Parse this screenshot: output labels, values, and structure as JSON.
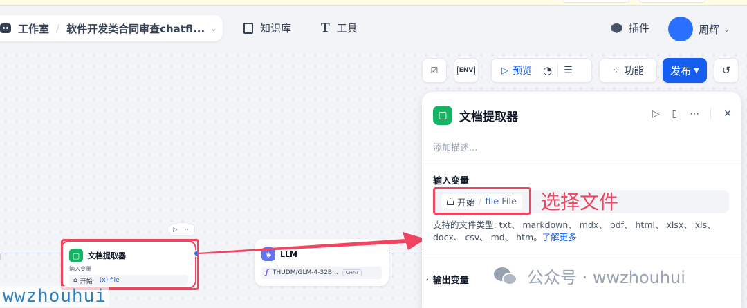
{
  "header": {
    "studio_label": "工作室",
    "app_name": "软件开发类合同审查chatfl...",
    "nav": [
      {
        "label": "知识库",
        "icon": "book-icon"
      },
      {
        "label": "工具",
        "icon": "tool-icon"
      }
    ],
    "plugin_label": "插件",
    "user_name": "周辉"
  },
  "toolbar": {
    "env_label": "ENV",
    "preview_label": "预览",
    "feature_label": "功能",
    "publish_label": "发布"
  },
  "canvas": {
    "doc_node": {
      "title": "文档提取器",
      "input_label": "输入变量",
      "source": "开始",
      "var": "(x) file"
    },
    "llm_node": {
      "title": "LLM",
      "model": "THUDM/GLM-4-32B...",
      "mode": "CHAT"
    }
  },
  "panel": {
    "title": "文档提取器",
    "desc_placeholder": "添加描述...",
    "input_section": "输入变量",
    "var_source": "开始",
    "var_name": "file",
    "var_type": "File",
    "annotation": "选择文件",
    "support_text": "支持的文件类型: txt、 markdown、 mdx、 pdf、 html、 xlsx、 xls、 docx、 csv、 md、 htm。",
    "learn_more": "了解更多",
    "output_section": "输出变量"
  },
  "watermark": {
    "wechat_text": "公众号 · wwzhouhui",
    "bottom_text": "wwzhouhui"
  },
  "colors": {
    "accent": "#155eef",
    "highlight": "#f04461",
    "doc_icon": "#16b364",
    "llm_icon": "#6172f3"
  }
}
